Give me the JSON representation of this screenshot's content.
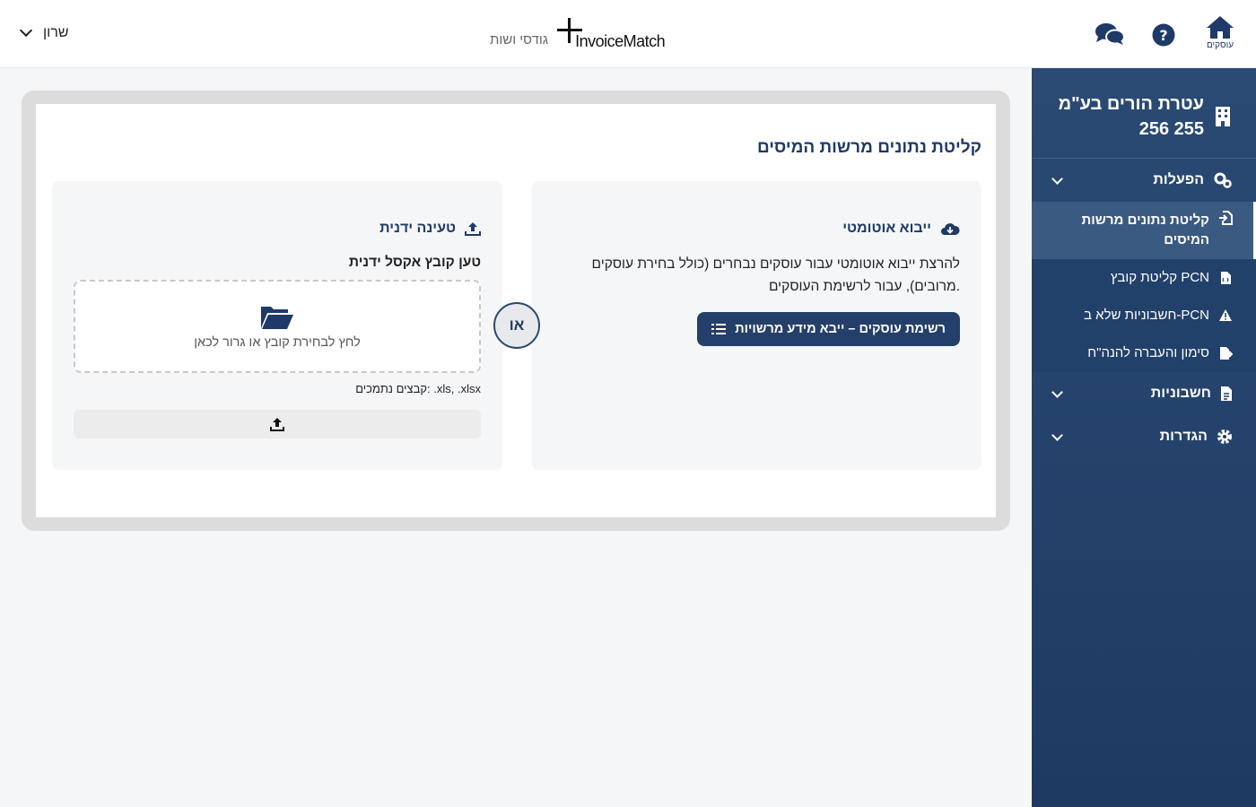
{
  "header": {
    "user_name": "שרון",
    "client_name": "גודסי ושות",
    "brand": "InvoiceMatch",
    "home_label": "עוסקים"
  },
  "sidebar": {
    "org_name": "עטרת הורים בע\"מ",
    "org_id": "256 255",
    "groups": [
      {
        "label": "הפעלות",
        "icon": "gears-icon",
        "items": [
          {
            "label": "קליטת נתונים מרשות המיסים",
            "icon": "file-import-icon",
            "active": true
          },
          {
            "label": "קליטת קובץ PCN",
            "icon": "file-code-icon"
          },
          {
            "label": "חשבוניות שלא ב-PCN",
            "icon": "warning-icon"
          },
          {
            "label": "סימון והעברה להנה\"ח",
            "icon": "file-export-icon"
          }
        ]
      },
      {
        "label": "חשבוניות",
        "icon": "document-icon"
      },
      {
        "label": "הגדרות",
        "icon": "settings-icon"
      }
    ]
  },
  "main": {
    "title": "קליטת נתונים מרשות המיסים",
    "auto": {
      "title": "ייבוא אוטומטי",
      "description": "להרצת ייבוא אוטומטי עבור עוסקים נבחרים (כולל בחירת עוסקים מרובים), עבור לרשימת העוסקים.",
      "button_label": "רשימת עוסקים – ייבא מידע מרשויות"
    },
    "or_label": "או",
    "manual": {
      "title": "טעינה ידנית",
      "subtitle": "טען קובץ אקסל ידנית",
      "dropzone_text": "לחץ לבחירת קובץ או גרור לכאן",
      "supported": "קבצים נתמכים: .xls, .xlsx"
    }
  },
  "colors": {
    "primary": "#243f6a",
    "sidebar": "#2a4a74",
    "accent_text": "#1f3a68"
  }
}
